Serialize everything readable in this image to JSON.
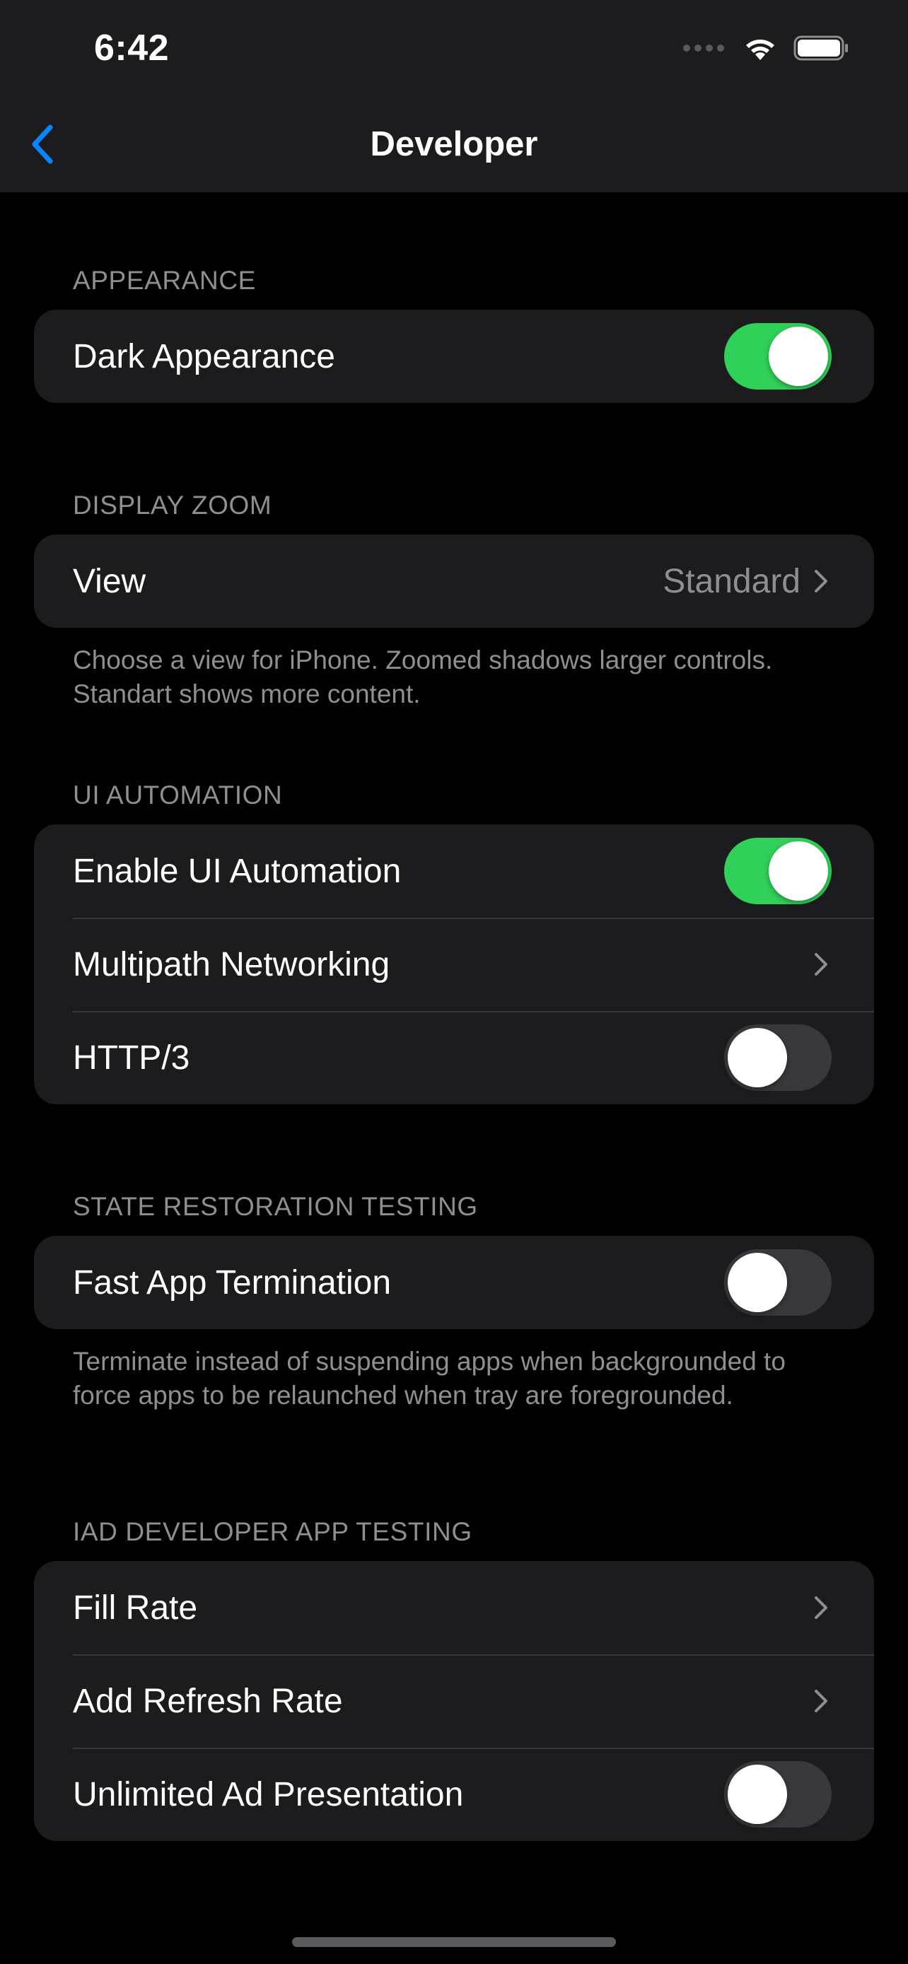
{
  "status_bar": {
    "time": "6:42"
  },
  "nav": {
    "title": "Developer",
    "back_icon": "chevron-left-icon",
    "accent_color": "#0a84ff"
  },
  "sections": {
    "appearance": {
      "header": "APPEARANCE",
      "rows": {
        "dark_appearance": {
          "label": "Dark Appearance",
          "toggle_on": true
        }
      }
    },
    "display_zoom": {
      "header": "DISPLAY ZOOM",
      "rows": {
        "view": {
          "label": "View",
          "value": "Standard"
        }
      },
      "footer": "Choose a view for iPhone. Zoomed shadows larger controls. Standart shows more content."
    },
    "ui_automation": {
      "header": "UI AUTOMATION",
      "rows": {
        "enable_ui_automation": {
          "label": "Enable UI Automation",
          "toggle_on": true
        },
        "multipath_networking": {
          "label": "Multipath Networking"
        },
        "http3": {
          "label": "HTTP/3",
          "toggle_on": false
        }
      }
    },
    "state_restoration": {
      "header": "STATE RESTORATION TESTING",
      "rows": {
        "fast_app_termination": {
          "label": "Fast App Termination",
          "toggle_on": false
        }
      },
      "footer": "Terminate instead of suspending apps when backgrounded to force apps to be relaunched when tray are foregrounded."
    },
    "iad_testing": {
      "header": "IAD DEVELOPER APP TESTING",
      "rows": {
        "fill_rate": {
          "label": "Fill Rate"
        },
        "add_refresh_rate": {
          "label": "Add Refresh Rate"
        },
        "unlimited_ad_presentation": {
          "label": "Unlimited Ad Presentation",
          "toggle_on": false
        }
      }
    }
  },
  "colors": {
    "background": "#000000",
    "cell_background": "#1c1c1e",
    "toggle_on": "#30d158",
    "toggle_off": "#39393d",
    "secondary_text": "#8e8e93"
  }
}
